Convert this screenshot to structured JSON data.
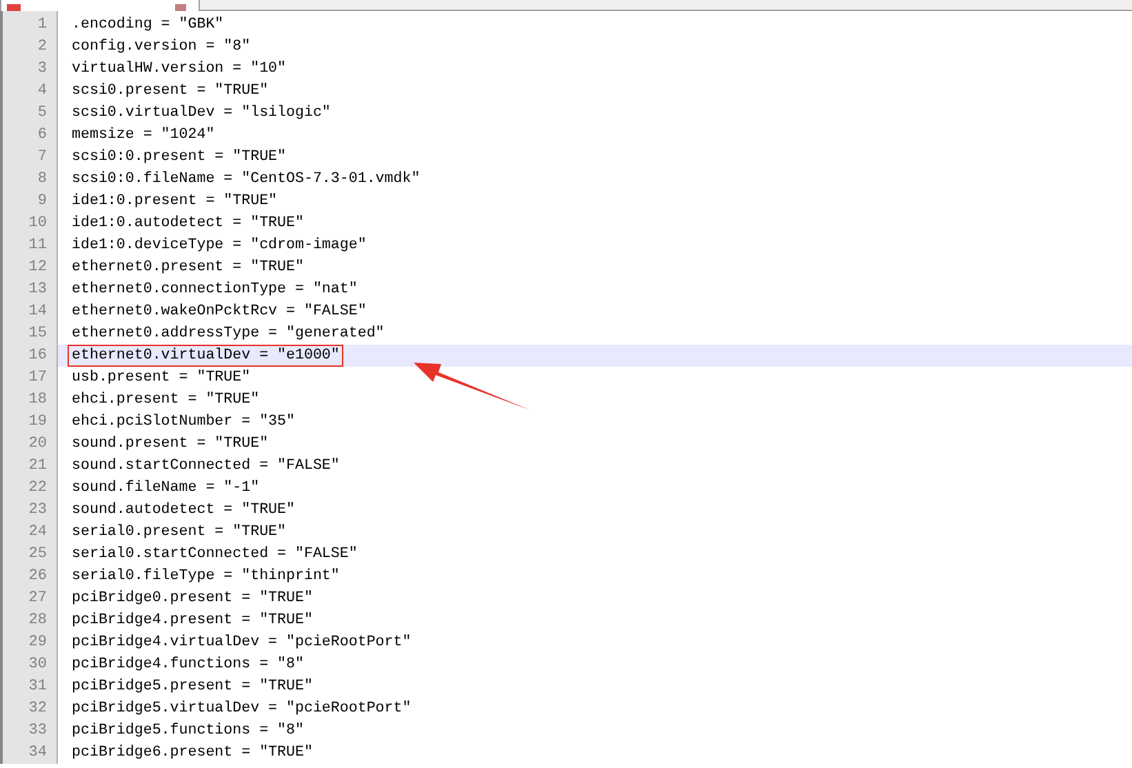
{
  "editor": {
    "lines": [
      {
        "number": "1",
        "text": ".encoding = \"GBK\"",
        "current": false,
        "boxed": false
      },
      {
        "number": "2",
        "text": "config.version = \"8\"",
        "current": false,
        "boxed": false
      },
      {
        "number": "3",
        "text": "virtualHW.version = \"10\"",
        "current": false,
        "boxed": false
      },
      {
        "number": "4",
        "text": "scsi0.present = \"TRUE\"",
        "current": false,
        "boxed": false
      },
      {
        "number": "5",
        "text": "scsi0.virtualDev = \"lsilogic\"",
        "current": false,
        "boxed": false
      },
      {
        "number": "6",
        "text": "memsize = \"1024\"",
        "current": false,
        "boxed": false
      },
      {
        "number": "7",
        "text": "scsi0:0.present = \"TRUE\"",
        "current": false,
        "boxed": false
      },
      {
        "number": "8",
        "text": "scsi0:0.fileName = \"CentOS-7.3-01.vmdk\"",
        "current": false,
        "boxed": false
      },
      {
        "number": "9",
        "text": "ide1:0.present = \"TRUE\"",
        "current": false,
        "boxed": false
      },
      {
        "number": "10",
        "text": "ide1:0.autodetect = \"TRUE\"",
        "current": false,
        "boxed": false
      },
      {
        "number": "11",
        "text": "ide1:0.deviceType = \"cdrom-image\"",
        "current": false,
        "boxed": false
      },
      {
        "number": "12",
        "text": "ethernet0.present = \"TRUE\"",
        "current": false,
        "boxed": false
      },
      {
        "number": "13",
        "text": "ethernet0.connectionType = \"nat\"",
        "current": false,
        "boxed": false
      },
      {
        "number": "14",
        "text": "ethernet0.wakeOnPcktRcv = \"FALSE\"",
        "current": false,
        "boxed": false
      },
      {
        "number": "15",
        "text": "ethernet0.addressType = \"generated\"",
        "current": false,
        "boxed": false
      },
      {
        "number": "16",
        "text": "ethernet0.virtualDev = \"e1000\"",
        "current": true,
        "boxed": true
      },
      {
        "number": "17",
        "text": "usb.present = \"TRUE\"",
        "current": false,
        "boxed": false
      },
      {
        "number": "18",
        "text": "ehci.present = \"TRUE\"",
        "current": false,
        "boxed": false
      },
      {
        "number": "19",
        "text": "ehci.pciSlotNumber = \"35\"",
        "current": false,
        "boxed": false
      },
      {
        "number": "20",
        "text": "sound.present = \"TRUE\"",
        "current": false,
        "boxed": false
      },
      {
        "number": "21",
        "text": "sound.startConnected = \"FALSE\"",
        "current": false,
        "boxed": false
      },
      {
        "number": "22",
        "text": "sound.fileName = \"-1\"",
        "current": false,
        "boxed": false
      },
      {
        "number": "23",
        "text": "sound.autodetect = \"TRUE\"",
        "current": false,
        "boxed": false
      },
      {
        "number": "24",
        "text": "serial0.present = \"TRUE\"",
        "current": false,
        "boxed": false
      },
      {
        "number": "25",
        "text": "serial0.startConnected = \"FALSE\"",
        "current": false,
        "boxed": false
      },
      {
        "number": "26",
        "text": "serial0.fileType = \"thinprint\"",
        "current": false,
        "boxed": false
      },
      {
        "number": "27",
        "text": "pciBridge0.present = \"TRUE\"",
        "current": false,
        "boxed": false
      },
      {
        "number": "28",
        "text": "pciBridge4.present = \"TRUE\"",
        "current": false,
        "boxed": false
      },
      {
        "number": "29",
        "text": "pciBridge4.virtualDev = \"pcieRootPort\"",
        "current": false,
        "boxed": false
      },
      {
        "number": "30",
        "text": "pciBridge4.functions = \"8\"",
        "current": false,
        "boxed": false
      },
      {
        "number": "31",
        "text": "pciBridge5.present = \"TRUE\"",
        "current": false,
        "boxed": false
      },
      {
        "number": "32",
        "text": "pciBridge5.virtualDev = \"pcieRootPort\"",
        "current": false,
        "boxed": false
      },
      {
        "number": "33",
        "text": "pciBridge5.functions = \"8\"",
        "current": false,
        "boxed": false
      },
      {
        "number": "34",
        "text": "pciBridge6.present = \"TRUE\"",
        "current": false,
        "boxed": false
      }
    ]
  }
}
